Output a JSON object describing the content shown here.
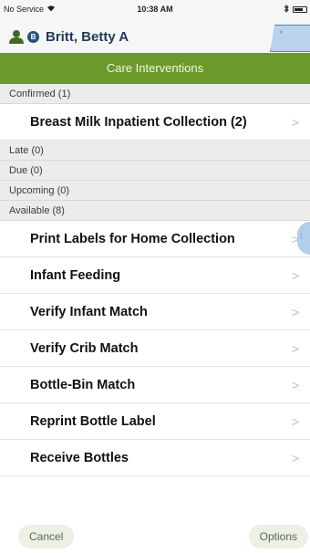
{
  "status_bar": {
    "carrier": "No Service",
    "time": "10:38 AM"
  },
  "patient": {
    "name": "Britt, Betty A",
    "badge_letter": "B"
  },
  "header": {
    "title": "Care Interventions"
  },
  "list": {
    "confirmed_label": "Confirmed (1)",
    "confirmed_items": [
      "Breast Milk Inpatient Collection (2)"
    ],
    "late_label": "Late (0)",
    "due_label": "Due (0)",
    "upcoming_label": "Upcoming (0)",
    "available_label": "Available (8)",
    "available_items": [
      "Print Labels for Home Collection",
      "Infant Feeding",
      "Verify Infant Match",
      "Verify Crib Match",
      "Bottle-Bin Match",
      "Reprint Bottle Label",
      "Receive Bottles"
    ]
  },
  "footer": {
    "cancel_label": "Cancel",
    "options_label": "Options"
  },
  "colors": {
    "header_green": "#6c9a2a",
    "patient_name_blue": "#1e3a5c",
    "section_gray": "#ececec"
  },
  "icons": {
    "wifi": "wifi-icon",
    "bluetooth": "bluetooth-icon",
    "battery": "battery-icon",
    "person": "person-icon",
    "chevron": "chevron-right-icon"
  }
}
